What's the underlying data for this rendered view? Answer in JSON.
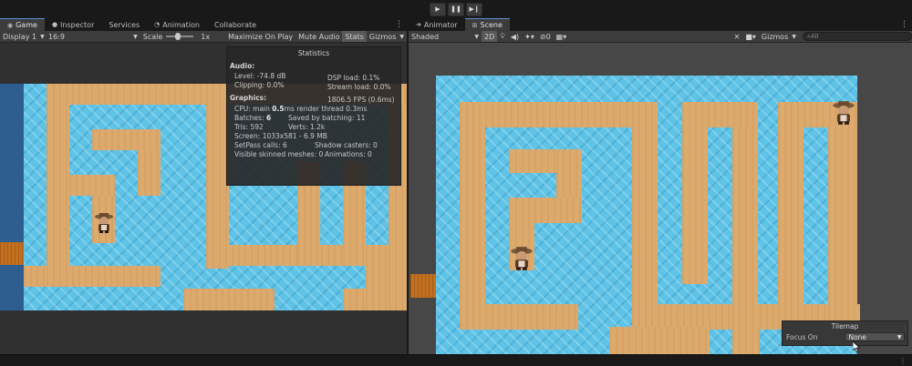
{
  "playbar": {
    "play_icon": "play-icon",
    "pause_icon": "pause-icon",
    "step_icon": "step-icon"
  },
  "left_tabs": [
    {
      "label": "Game",
      "icon": "gamepad-icon"
    },
    {
      "label": "Inspector",
      "icon": "info-icon"
    },
    {
      "label": "Services"
    },
    {
      "label": "Animation",
      "icon": "clock-icon"
    },
    {
      "label": "Collaborate"
    }
  ],
  "game_toolbar": {
    "display": "Display 1",
    "aspect": "16:9",
    "scale_label": "Scale",
    "scale_value": "1x",
    "maximize": "Maximize On Play",
    "mute": "Mute Audio",
    "stats": "Stats",
    "gizmos": "Gizmos"
  },
  "stats": {
    "title": "Statistics",
    "audio_header": "Audio:",
    "level": "Level: -74.8 dB",
    "dsp": "DSP load: 0.1%",
    "clipping": "Clipping: 0.0%",
    "stream": "Stream load: 0.0%",
    "graphics_header": "Graphics:",
    "fps": "1806.5 FPS (0.6ms)",
    "cpu_prefix": "CPU: main ",
    "cpu_main": "0.5",
    "cpu_suffix": "ms  render thread 0.3ms",
    "batches_prefix": "Batches: ",
    "batches": "6",
    "saved": "Saved by batching: 11",
    "tris": "Tris: 592",
    "verts": "Verts: 1.2k",
    "screen": "Screen: 1033x581 - 6.9 MB",
    "setpass": "SetPass calls: 6",
    "shadow": "Shadow casters: 0",
    "skinned": "Visible skinned meshes: 0",
    "animations": "Animations: 0"
  },
  "right_tabs": [
    {
      "label": "Animator",
      "icon": "animator-icon"
    },
    {
      "label": "Scene",
      "icon": "grid-icon"
    }
  ],
  "scene_toolbar": {
    "shading": "Shaded",
    "mode_2d": "2D",
    "gizmos": "Gizmos",
    "search_placeholder": "All",
    "hidden_count": "0"
  },
  "tilemap": {
    "title": "Tilemap",
    "focus_label": "Focus On",
    "focus_value": "None"
  },
  "colors": {
    "water": "#5ec3e6",
    "sand": "#ddaa6e",
    "wall": "#2e5d8f",
    "accent": "#5a8fd8"
  }
}
